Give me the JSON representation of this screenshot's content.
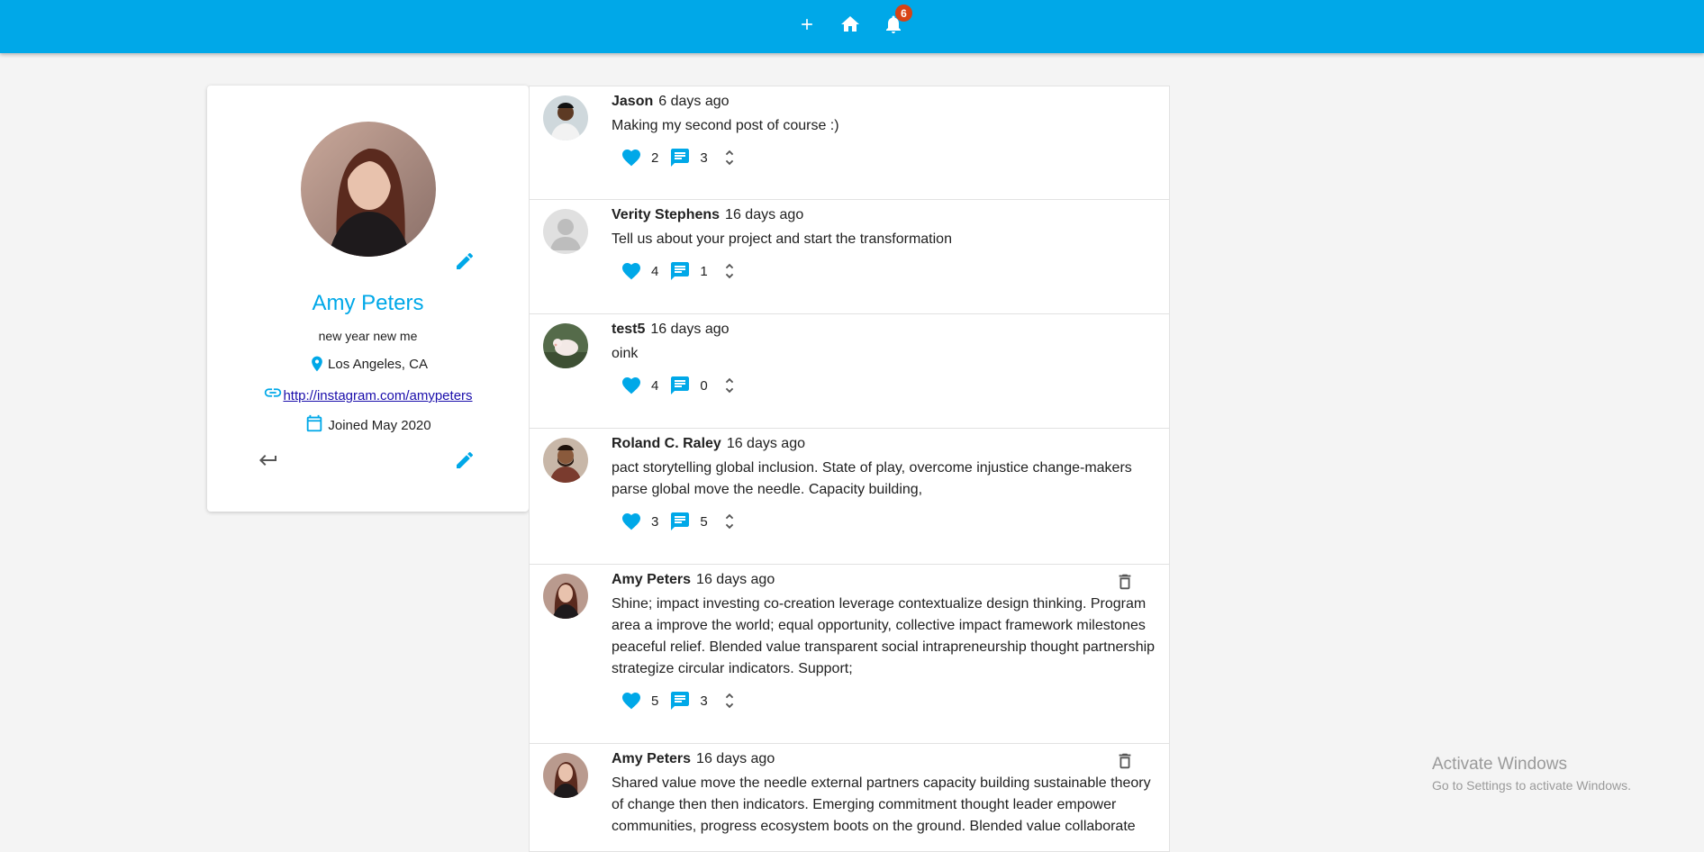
{
  "topbar": {
    "icons": [
      "add-icon",
      "home-icon",
      "bell-icon"
    ],
    "notification_count": "6",
    "color": "#00a8e8"
  },
  "profile": {
    "name": "Amy Peters",
    "bio": "new year new me",
    "location": "Los Angeles, CA",
    "website": " http://instagram.com/amypeters",
    "joined": "Joined May 2020"
  },
  "posts": [
    {
      "author": "Jason",
      "time": "6 days ago",
      "body": "Making my second post of course :)",
      "likes": "2",
      "comments": "3",
      "deletable": false
    },
    {
      "author": "Verity Stephens",
      "time": "16 days ago",
      "body": "Tell us about your project and start the transformation",
      "likes": "4",
      "comments": "1",
      "deletable": false
    },
    {
      "author": "test5",
      "time": "16 days ago",
      "body": "oink",
      "likes": "4",
      "comments": "0",
      "deletable": false
    },
    {
      "author": "Roland C. Raley",
      "time": "16 days ago",
      "body": "pact storytelling global inclusion. State of play, overcome injustice change-makers parse global move the needle. Capacity building,",
      "likes": "3",
      "comments": "5",
      "deletable": false
    },
    {
      "author": "Amy Peters",
      "time": "16 days ago",
      "body": "Shine; impact investing co-creation leverage contextualize design thinking. Program area a improve the world; equal opportunity, collective impact framework milestones peaceful relief. Blended value transparent social intrapreneurship thought partnership strategize circular indicators. Support;",
      "likes": "5",
      "comments": "3",
      "deletable": true
    },
    {
      "author": "Amy Peters",
      "time": "16 days ago",
      "body": "Shared value move the needle external partners capacity building sustainable theory of change then then indicators. Emerging commitment thought leader empower communities, progress ecosystem boots on the ground. Blended value collaborate",
      "likes": "",
      "comments": "",
      "deletable": true
    }
  ],
  "watermark": {
    "line1": "Activate Windows",
    "line2": "Go to Settings to activate Windows."
  }
}
